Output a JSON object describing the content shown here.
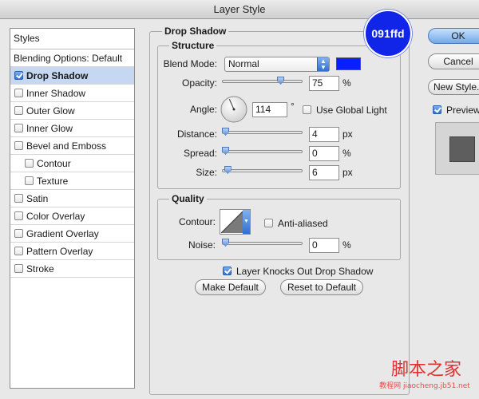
{
  "window": {
    "title": "Layer Style"
  },
  "styles_panel": {
    "header": "Styles",
    "items": [
      {
        "label": "Blending Options: Default",
        "has_checkbox": false,
        "checked": false,
        "selected": false,
        "indent": 0
      },
      {
        "label": "Drop Shadow",
        "has_checkbox": true,
        "checked": true,
        "selected": true,
        "indent": 1
      },
      {
        "label": "Inner Shadow",
        "has_checkbox": true,
        "checked": false,
        "selected": false,
        "indent": 1
      },
      {
        "label": "Outer Glow",
        "has_checkbox": true,
        "checked": false,
        "selected": false,
        "indent": 1
      },
      {
        "label": "Inner Glow",
        "has_checkbox": true,
        "checked": false,
        "selected": false,
        "indent": 1
      },
      {
        "label": "Bevel and Emboss",
        "has_checkbox": true,
        "checked": false,
        "selected": false,
        "indent": 1
      },
      {
        "label": "Contour",
        "has_checkbox": true,
        "checked": false,
        "selected": false,
        "indent": 2
      },
      {
        "label": "Texture",
        "has_checkbox": true,
        "checked": false,
        "selected": false,
        "indent": 2
      },
      {
        "label": "Satin",
        "has_checkbox": true,
        "checked": false,
        "selected": false,
        "indent": 1
      },
      {
        "label": "Color Overlay",
        "has_checkbox": true,
        "checked": false,
        "selected": false,
        "indent": 1
      },
      {
        "label": "Gradient Overlay",
        "has_checkbox": true,
        "checked": false,
        "selected": false,
        "indent": 1
      },
      {
        "label": "Pattern Overlay",
        "has_checkbox": true,
        "checked": false,
        "selected": false,
        "indent": 1
      },
      {
        "label": "Stroke",
        "has_checkbox": true,
        "checked": false,
        "selected": false,
        "indent": 1
      }
    ]
  },
  "drop_shadow": {
    "title": "Drop Shadow",
    "structure": {
      "title": "Structure",
      "blend_mode_label": "Blend Mode:",
      "blend_mode_value": "Normal",
      "shadow_color": "#091ffd",
      "opacity_label": "Opacity:",
      "opacity_value": "75",
      "opacity_unit": "%",
      "opacity_level": 0.75,
      "angle_label": "Angle:",
      "angle_value": "114",
      "angle_unit": "°",
      "angle_degrees": 114,
      "use_global_light_label": "Use Global Light",
      "use_global_light_checked": false,
      "distance_label": "Distance:",
      "distance_value": "4",
      "distance_unit": "px",
      "distance_level": 0.0,
      "spread_label": "Spread:",
      "spread_value": "0",
      "spread_unit": "%",
      "spread_level": 0.0,
      "size_label": "Size:",
      "size_value": "6",
      "size_unit": "px",
      "size_level": 0.03
    },
    "quality": {
      "title": "Quality",
      "contour_label": "Contour:",
      "anti_aliased_label": "Anti-aliased",
      "anti_aliased_checked": false,
      "noise_label": "Noise:",
      "noise_value": "0",
      "noise_unit": "%",
      "noise_level": 0.0
    },
    "knocks_out_label": "Layer Knocks Out Drop Shadow",
    "knocks_out_checked": true,
    "make_default_label": "Make Default",
    "reset_default_label": "Reset to Default"
  },
  "actions": {
    "ok_label": "OK",
    "cancel_label": "Cancel",
    "new_style_label": "New Style...",
    "preview_label": "Preview",
    "preview_checked": true
  },
  "callout": {
    "text": "091ffd",
    "color": "#1025e8"
  },
  "watermark": {
    "text": "脚本之家",
    "subtext": "教程网 jiaocheng.jb51.net"
  }
}
